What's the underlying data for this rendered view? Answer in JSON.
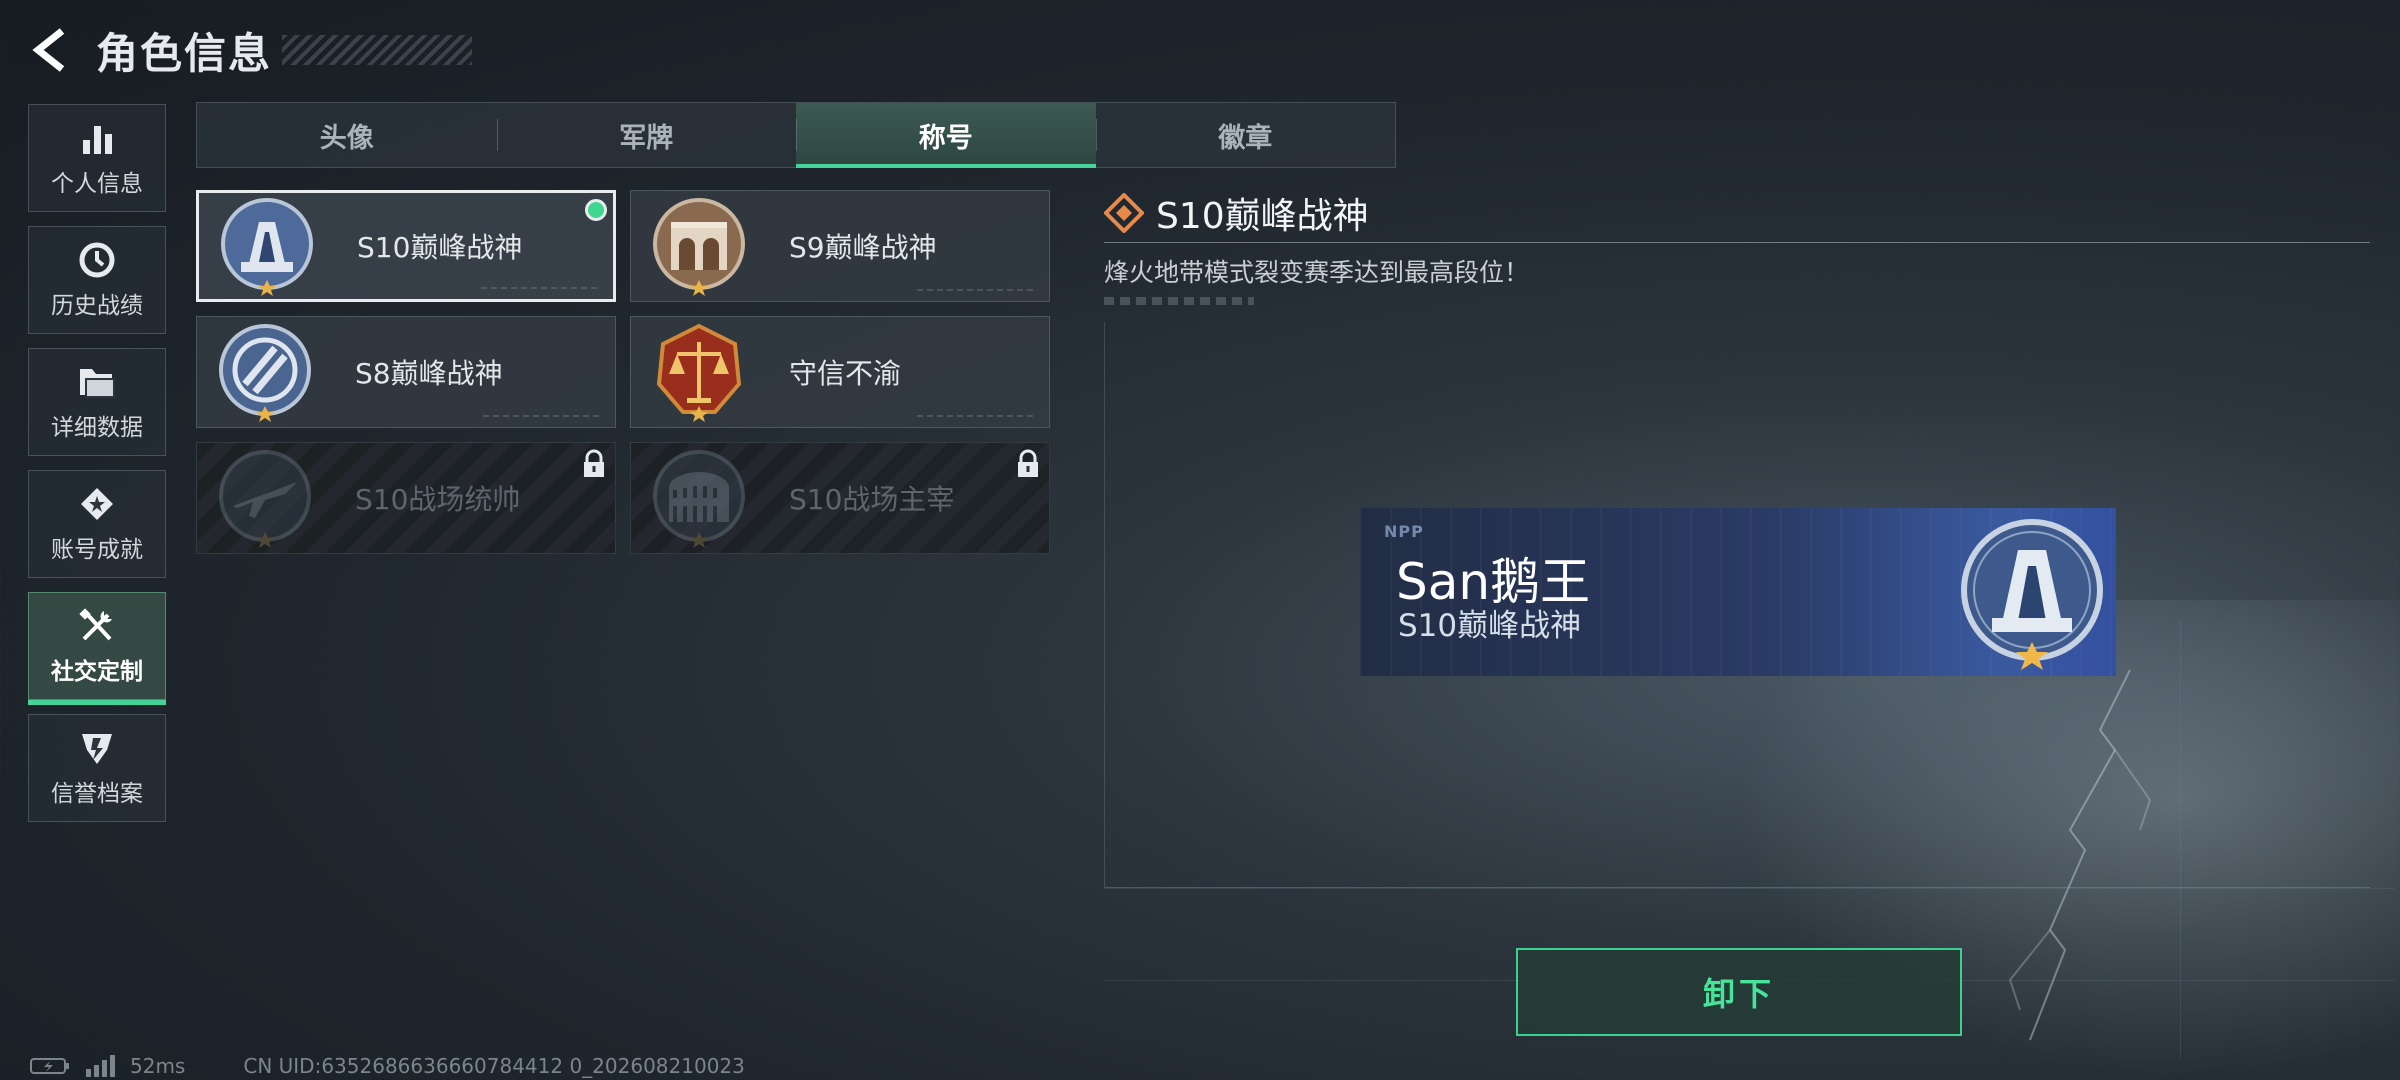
{
  "header": {
    "title": "角色信息",
    "back_icon": "chevron-left-icon"
  },
  "sidebar": {
    "items": [
      {
        "label": "个人信息",
        "icon": "bar-chart-icon",
        "active": false
      },
      {
        "label": "历史战绩",
        "icon": "clock-icon",
        "active": false
      },
      {
        "label": "详细数据",
        "icon": "folder-icon",
        "active": false
      },
      {
        "label": "账号成就",
        "icon": "achievement-icon",
        "active": false
      },
      {
        "label": "社交定制",
        "icon": "tools-icon",
        "active": true
      },
      {
        "label": "信誉档案",
        "icon": "shield-badge-icon",
        "active": false
      }
    ]
  },
  "tabs": [
    {
      "label": "头像",
      "active": false
    },
    {
      "label": "军牌",
      "active": false
    },
    {
      "label": "称号",
      "active": true
    },
    {
      "label": "徽章",
      "active": false
    }
  ],
  "titles": [
    {
      "name": "S10巅峰战神",
      "selected": true,
      "equipped": true,
      "locked": false,
      "badge": "s10-peak-badge-icon"
    },
    {
      "name": "S9巅峰战神",
      "selected": false,
      "equipped": false,
      "locked": false,
      "badge": "s9-peak-badge-icon"
    },
    {
      "name": "S8巅峰战神",
      "selected": false,
      "equipped": false,
      "locked": false,
      "badge": "s8-peak-badge-icon"
    },
    {
      "name": "守信不渝",
      "selected": false,
      "equipped": false,
      "locked": false,
      "badge": "scales-badge-icon"
    },
    {
      "name": "S10战场统帅",
      "selected": false,
      "equipped": false,
      "locked": true,
      "badge": "aircraft-badge-icon"
    },
    {
      "name": "S10战场主宰",
      "selected": false,
      "equipped": false,
      "locked": true,
      "badge": "colosseum-badge-icon"
    }
  ],
  "detail": {
    "title": "S10巅峰战神",
    "description": "烽火地带模式裂变赛季达到最高段位！"
  },
  "nameplate": {
    "logo": "NPP",
    "player_name": "San鹅王",
    "title": "S10巅峰战神"
  },
  "actions": {
    "unequip_label": "卸下"
  },
  "status": {
    "ping": "52ms",
    "uid": "CN UID:6352686636660784412 0_202608210023"
  },
  "colors": {
    "accent": "#45d39a",
    "background": "#1f262d",
    "nameplate": "#2a3b66"
  }
}
